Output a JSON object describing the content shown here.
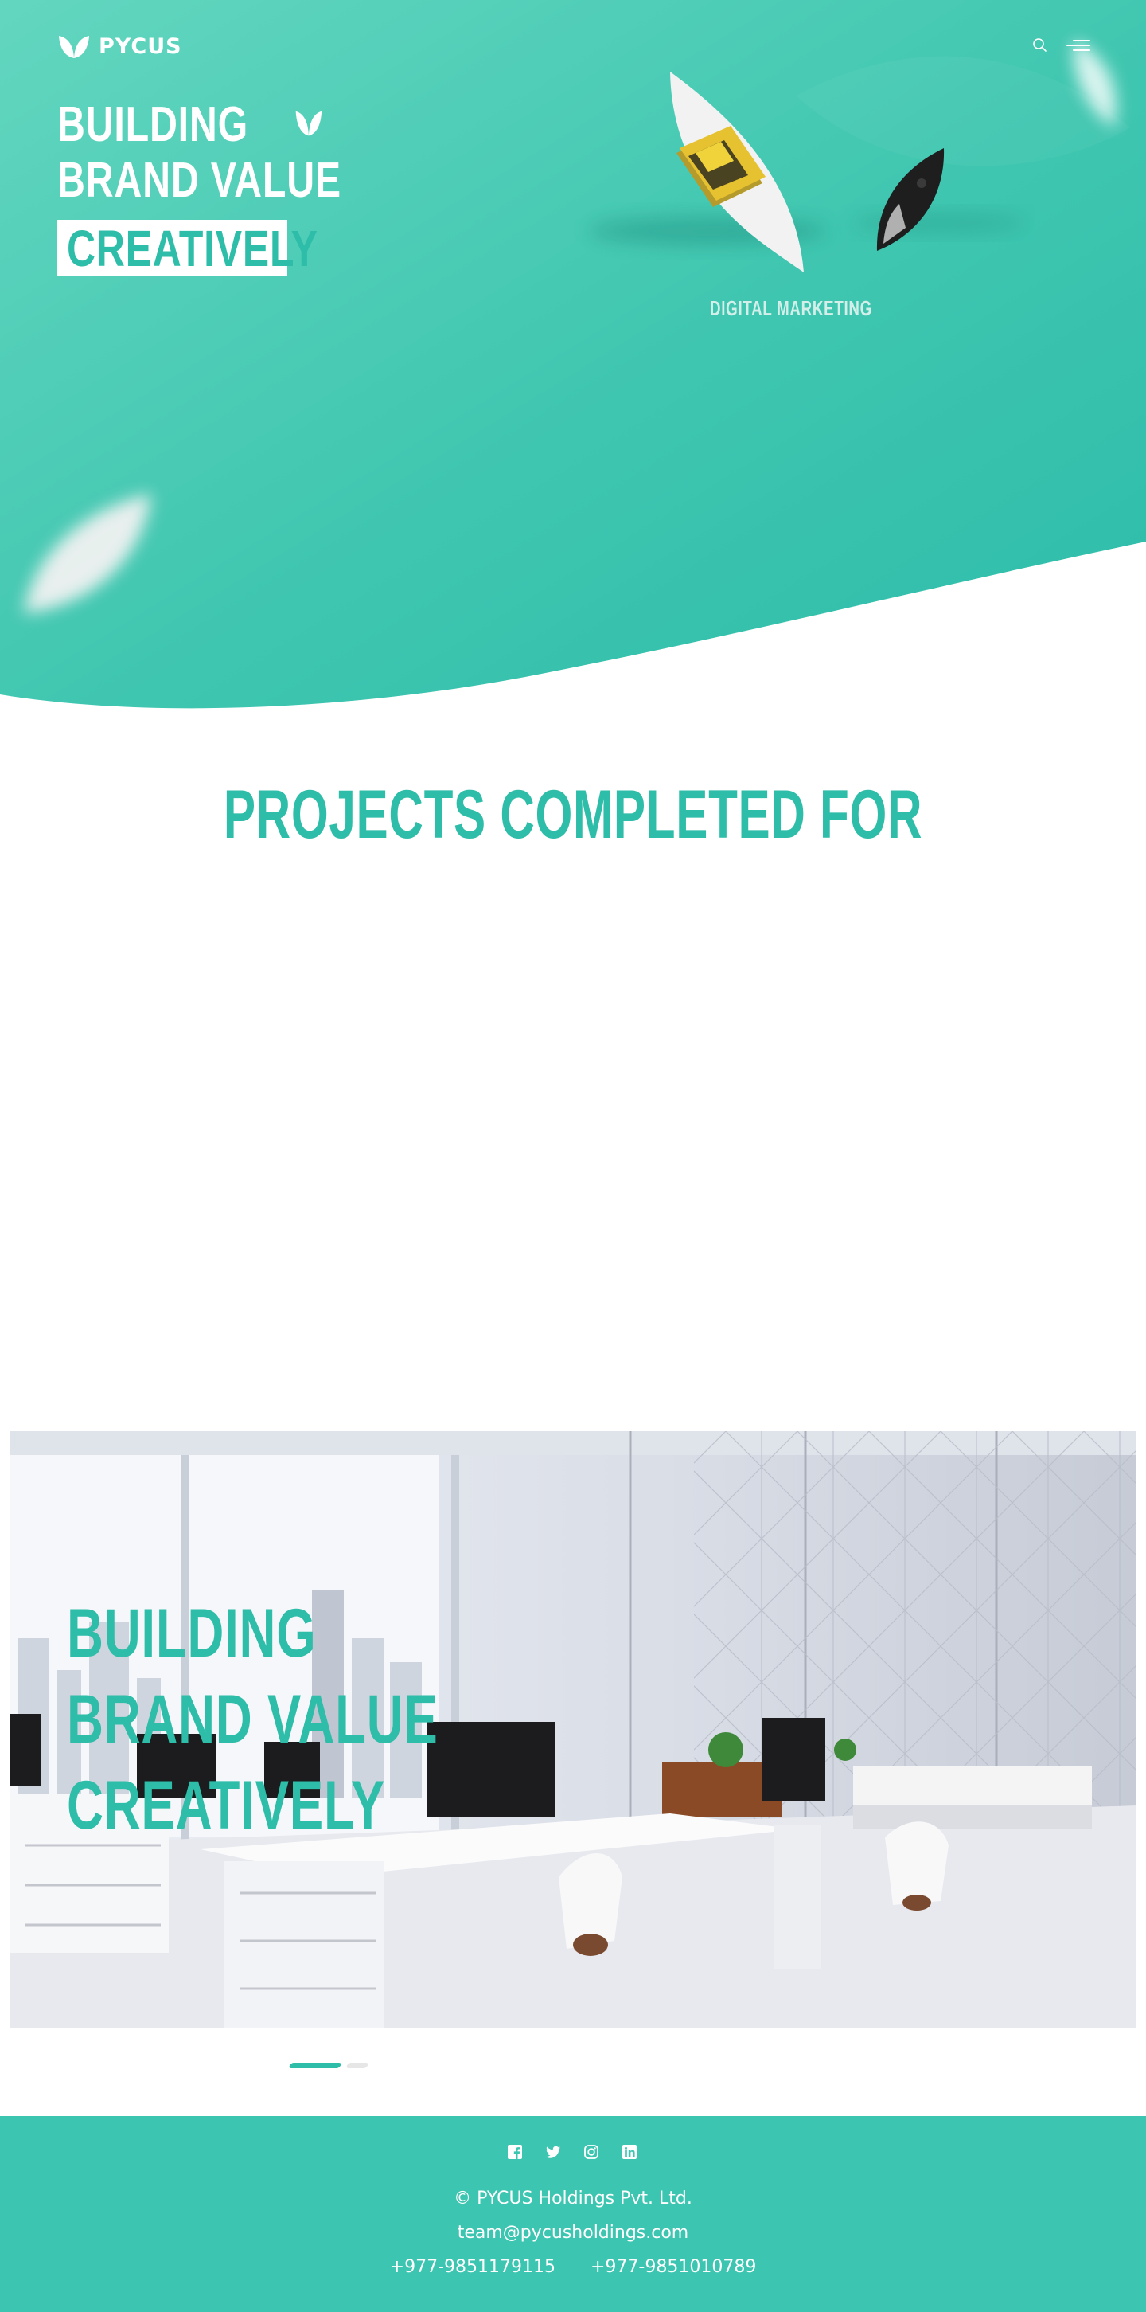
{
  "brand": {
    "name": "PYCUS",
    "accent_color": "#2dbda8",
    "footer_color": "#3cc5b0"
  },
  "header": {
    "logo_icon": "leaf-logo-icon",
    "search_icon": "search-icon",
    "menu_icon": "hamburger-menu-icon"
  },
  "hero": {
    "line1": "BUILDING",
    "line2": "BRAND VALUE",
    "highlight": "CREATIVELY",
    "showcase_label": "DIGITAL MARKETING"
  },
  "projects": {
    "title": "PROJECTS COMPLETED FOR"
  },
  "banner": {
    "line1": "BUILDING",
    "line2": "BRAND VALUE",
    "line3": "CREATIVELY",
    "image": "office-interior-photo"
  },
  "slider": {
    "slides": 2,
    "active": 1
  },
  "footer": {
    "socials": [
      "facebook-icon",
      "twitter-icon",
      "instagram-icon",
      "linkedin-icon"
    ],
    "copyright": "© PYCUS Holdings Pvt. Ltd.",
    "email": "team@pycusholdings.com",
    "phone1": "+977-9851179115",
    "phone2": "+977-9851010789"
  }
}
